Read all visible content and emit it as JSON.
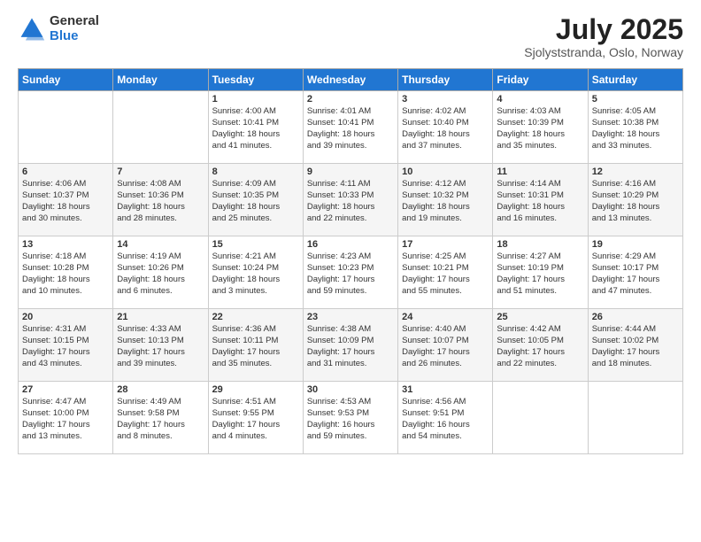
{
  "header": {
    "logo_general": "General",
    "logo_blue": "Blue",
    "month_title": "July 2025",
    "location": "Sjolyststranda, Oslo, Norway"
  },
  "days_of_week": [
    "Sunday",
    "Monday",
    "Tuesday",
    "Wednesday",
    "Thursday",
    "Friday",
    "Saturday"
  ],
  "weeks": [
    [
      {
        "day": "",
        "info": ""
      },
      {
        "day": "",
        "info": ""
      },
      {
        "day": "1",
        "info": "Sunrise: 4:00 AM\nSunset: 10:41 PM\nDaylight: 18 hours\nand 41 minutes."
      },
      {
        "day": "2",
        "info": "Sunrise: 4:01 AM\nSunset: 10:41 PM\nDaylight: 18 hours\nand 39 minutes."
      },
      {
        "day": "3",
        "info": "Sunrise: 4:02 AM\nSunset: 10:40 PM\nDaylight: 18 hours\nand 37 minutes."
      },
      {
        "day": "4",
        "info": "Sunrise: 4:03 AM\nSunset: 10:39 PM\nDaylight: 18 hours\nand 35 minutes."
      },
      {
        "day": "5",
        "info": "Sunrise: 4:05 AM\nSunset: 10:38 PM\nDaylight: 18 hours\nand 33 minutes."
      }
    ],
    [
      {
        "day": "6",
        "info": "Sunrise: 4:06 AM\nSunset: 10:37 PM\nDaylight: 18 hours\nand 30 minutes."
      },
      {
        "day": "7",
        "info": "Sunrise: 4:08 AM\nSunset: 10:36 PM\nDaylight: 18 hours\nand 28 minutes."
      },
      {
        "day": "8",
        "info": "Sunrise: 4:09 AM\nSunset: 10:35 PM\nDaylight: 18 hours\nand 25 minutes."
      },
      {
        "day": "9",
        "info": "Sunrise: 4:11 AM\nSunset: 10:33 PM\nDaylight: 18 hours\nand 22 minutes."
      },
      {
        "day": "10",
        "info": "Sunrise: 4:12 AM\nSunset: 10:32 PM\nDaylight: 18 hours\nand 19 minutes."
      },
      {
        "day": "11",
        "info": "Sunrise: 4:14 AM\nSunset: 10:31 PM\nDaylight: 18 hours\nand 16 minutes."
      },
      {
        "day": "12",
        "info": "Sunrise: 4:16 AM\nSunset: 10:29 PM\nDaylight: 18 hours\nand 13 minutes."
      }
    ],
    [
      {
        "day": "13",
        "info": "Sunrise: 4:18 AM\nSunset: 10:28 PM\nDaylight: 18 hours\nand 10 minutes."
      },
      {
        "day": "14",
        "info": "Sunrise: 4:19 AM\nSunset: 10:26 PM\nDaylight: 18 hours\nand 6 minutes."
      },
      {
        "day": "15",
        "info": "Sunrise: 4:21 AM\nSunset: 10:24 PM\nDaylight: 18 hours\nand 3 minutes."
      },
      {
        "day": "16",
        "info": "Sunrise: 4:23 AM\nSunset: 10:23 PM\nDaylight: 17 hours\nand 59 minutes."
      },
      {
        "day": "17",
        "info": "Sunrise: 4:25 AM\nSunset: 10:21 PM\nDaylight: 17 hours\nand 55 minutes."
      },
      {
        "day": "18",
        "info": "Sunrise: 4:27 AM\nSunset: 10:19 PM\nDaylight: 17 hours\nand 51 minutes."
      },
      {
        "day": "19",
        "info": "Sunrise: 4:29 AM\nSunset: 10:17 PM\nDaylight: 17 hours\nand 47 minutes."
      }
    ],
    [
      {
        "day": "20",
        "info": "Sunrise: 4:31 AM\nSunset: 10:15 PM\nDaylight: 17 hours\nand 43 minutes."
      },
      {
        "day": "21",
        "info": "Sunrise: 4:33 AM\nSunset: 10:13 PM\nDaylight: 17 hours\nand 39 minutes."
      },
      {
        "day": "22",
        "info": "Sunrise: 4:36 AM\nSunset: 10:11 PM\nDaylight: 17 hours\nand 35 minutes."
      },
      {
        "day": "23",
        "info": "Sunrise: 4:38 AM\nSunset: 10:09 PM\nDaylight: 17 hours\nand 31 minutes."
      },
      {
        "day": "24",
        "info": "Sunrise: 4:40 AM\nSunset: 10:07 PM\nDaylight: 17 hours\nand 26 minutes."
      },
      {
        "day": "25",
        "info": "Sunrise: 4:42 AM\nSunset: 10:05 PM\nDaylight: 17 hours\nand 22 minutes."
      },
      {
        "day": "26",
        "info": "Sunrise: 4:44 AM\nSunset: 10:02 PM\nDaylight: 17 hours\nand 18 minutes."
      }
    ],
    [
      {
        "day": "27",
        "info": "Sunrise: 4:47 AM\nSunset: 10:00 PM\nDaylight: 17 hours\nand 13 minutes."
      },
      {
        "day": "28",
        "info": "Sunrise: 4:49 AM\nSunset: 9:58 PM\nDaylight: 17 hours\nand 8 minutes."
      },
      {
        "day": "29",
        "info": "Sunrise: 4:51 AM\nSunset: 9:55 PM\nDaylight: 17 hours\nand 4 minutes."
      },
      {
        "day": "30",
        "info": "Sunrise: 4:53 AM\nSunset: 9:53 PM\nDaylight: 16 hours\nand 59 minutes."
      },
      {
        "day": "31",
        "info": "Sunrise: 4:56 AM\nSunset: 9:51 PM\nDaylight: 16 hours\nand 54 minutes."
      },
      {
        "day": "",
        "info": ""
      },
      {
        "day": "",
        "info": ""
      }
    ]
  ]
}
